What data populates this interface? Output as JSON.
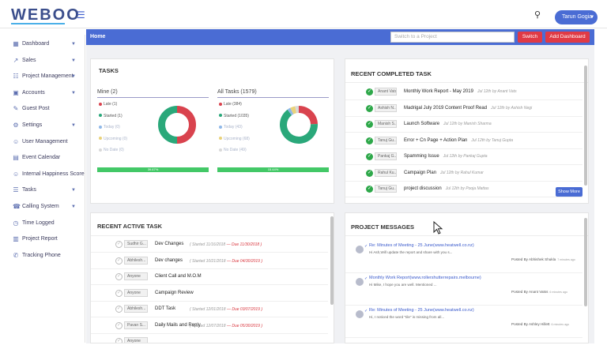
{
  "app": {
    "logo": "WEBOO",
    "user_name": "Tarun Gogia"
  },
  "sidebar": {
    "items": [
      {
        "label": "Dashboard",
        "icon": "dashboard-icon",
        "has_arrow": true
      },
      {
        "label": "Sales",
        "icon": "chart-icon",
        "has_arrow": true
      },
      {
        "label": "Project Management",
        "icon": "project-icon",
        "has_arrow": true
      },
      {
        "label": "Accounts",
        "icon": "accounts-icon",
        "has_arrow": true
      },
      {
        "label": "Guest Post",
        "icon": "guest-post-icon",
        "has_arrow": false
      },
      {
        "label": "Settings",
        "icon": "gear-icon",
        "has_arrow": true
      },
      {
        "label": "User Management",
        "icon": "user-icon",
        "has_arrow": false
      },
      {
        "label": "Event Calendar",
        "icon": "calendar-icon",
        "has_arrow": false
      },
      {
        "label": "Internal Happiness Score",
        "icon": "smile-icon",
        "has_arrow": false
      },
      {
        "label": "Tasks",
        "icon": "tasks-icon",
        "has_arrow": true
      },
      {
        "label": "Calling System",
        "icon": "phone-icon",
        "has_arrow": true
      },
      {
        "label": "Time Logged",
        "icon": "clock-icon",
        "has_arrow": false
      },
      {
        "label": "Project Report",
        "icon": "report-icon",
        "has_arrow": false
      },
      {
        "label": "Tracking Phone",
        "icon": "tracking-phone-icon",
        "has_arrow": false
      }
    ]
  },
  "header": {
    "title": "Home",
    "switch_placeholder": "Switch to a Project",
    "switch_button": "Switch",
    "add_dashboard_button": "Add Dashboard"
  },
  "tasks_panel": {
    "title": "TASKS",
    "mine": {
      "heading": "Mine (2)",
      "legend": [
        "Late (1)",
        "Started (1)",
        "Today (0)",
        "Upcoming (0)",
        "No Date (0)"
      ],
      "progress_label": "39.67%",
      "progress": 0.3967,
      "slices": [
        1,
        1,
        0,
        0,
        0
      ]
    },
    "all": {
      "heading": "All Tasks (1579)",
      "legend": [
        "Late (384)",
        "Started (1035)",
        "Today (43)",
        "Upcoming (68)",
        "No Date (49)"
      ],
      "progress_label": "15.44%",
      "progress": 0.1544,
      "slices": [
        384,
        1035,
        43,
        68,
        49
      ]
    },
    "colors": {
      "late": "#d9434e",
      "started": "#2aa87a",
      "today": "#8fb8e8",
      "upcoming": "#e9d27a",
      "nodate": "#d9d9d9"
    }
  },
  "recent_completed": {
    "title": "RECENT COMPLETED TASK",
    "rows": [
      {
        "user": "Anant Vats",
        "task": "Monthly Work Report - May 2019",
        "meta": "Jul 12th by Anant Vats"
      },
      {
        "user": "Ashish N...",
        "task": "Madrigal July 2019 Content Proof Read",
        "meta": "Jul 12th by Ashish Negi"
      },
      {
        "user": "Manish S...",
        "task": "Launch Software",
        "meta": "Jul 12th by Manish Sharma"
      },
      {
        "user": "Tanuj Gu...",
        "task": "Error + Cn Page + Action Plan",
        "meta": "Jul 12th by Tanuj Gupta"
      },
      {
        "user": "Pankaj G...",
        "task": "Spamming Issue",
        "meta": "Jul 12th by Pankaj Gupta"
      },
      {
        "user": "Rahul Ku...",
        "task": "Campaign Plan",
        "meta": "Jul 12th by Rahul Kumar"
      },
      {
        "user": "Tanuj Gu...",
        "task": "project discussion",
        "meta": "Jul 12th by Pooja Mattas"
      }
    ],
    "show_more": "Show More"
  },
  "recent_active": {
    "title": "RECENT ACTIVE TASK",
    "rows": [
      {
        "user": "Sudhir G...",
        "task": "Dev Changes",
        "started": "( Started 11/16/2018",
        "due": "Due 11/30/2018 )"
      },
      {
        "user": "Abhilesh...",
        "task": "Dev changes",
        "started": "( Started 10/21/2018",
        "due": "Due 04/30/2019 )"
      },
      {
        "user": "Anyone",
        "task": "Client Call and M.O.M",
        "started": "",
        "due": ""
      },
      {
        "user": "Anyone",
        "task": "Campaign Review",
        "started": "",
        "due": ""
      },
      {
        "user": "Abhilesh...",
        "task": "DDT Task",
        "started": "( Started 12/01/2018",
        "due": "Due 03/07/2019 )"
      },
      {
        "user": "Pavan S...",
        "task": "Daily Mails and Reply",
        "started": "( Started 12/07/2018",
        "due": "Due 05/30/2019 )"
      },
      {
        "user": "Anyone",
        "task": "",
        "started": "",
        "due": ""
      }
    ]
  },
  "project_messages": {
    "title": "PROJECT MESSAGES",
    "messages": [
      {
        "title": "Re: Minutes of Meeting - 25 June(www.heatwell.co.nz)",
        "body": "Hi Ash,Will update the report and share with you s...",
        "by": "Posted By Abhishek Shukla",
        "time": "7 minutes ago"
      },
      {
        "title": "Monthly Work Report(www.rollershutterrepairs.melbourne)",
        "body": "Hi Mike, I hope you are well. Mentioned ...",
        "by": "Posted By Anant Vatss",
        "time": "6 minutes ago"
      },
      {
        "title": "Re: Minutes of Meeting - 25 June(www.heatwell.co.nz)",
        "body": "Hi, I noticed the word \"tile\" is missing from all...",
        "by": "Posted By Ashley Hillett",
        "time": "6 minutes ago"
      }
    ]
  }
}
